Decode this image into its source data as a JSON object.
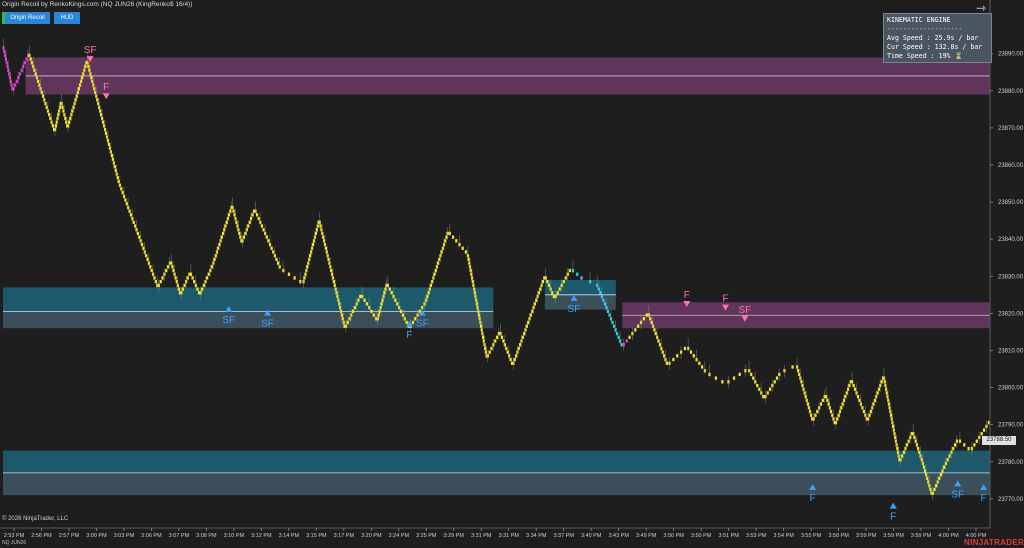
{
  "window": {
    "title": "Origin Recoil by RenkoKings.com (NQ JUN26 (KingRenko$ 16/4))",
    "buttons": [
      "Origin Recoil",
      "HUD"
    ],
    "copyright": "© 2026 NinjaTrader, LLC",
    "instrument": "NQ JUN26",
    "brand": "NINJATRADER"
  },
  "hud": {
    "header": "KINEMATIC ENGINE",
    "separator": "-------------------",
    "avg_speed": "Avg Speed  : 25.9s / bar",
    "cur_speed": "Cur Speed  : 132.8s / bar",
    "time_speed": "Time Speed : 19% ⌛"
  },
  "colors": {
    "background": "#1e1e1e",
    "up_brick": "#f5e62a",
    "down_brick": "#f5e62a",
    "wick": "#9a9a9a",
    "supply_zone": "#6b3a64",
    "demand_zone": "#1e5f73",
    "zone_lower": "#3d5460",
    "bear_marker": "#ff6fa8",
    "bull_marker": "#3aa0ff",
    "cyan_brick": "#2fd0e6",
    "magenta_brick": "#e63ad6"
  },
  "chart_data": {
    "type": "renko",
    "yaxis": {
      "ticks": [
        23890,
        23880,
        23870,
        23860,
        23850,
        23840,
        23830,
        23820,
        23810,
        23800,
        23790,
        23780,
        23770
      ],
      "ylim": [
        23767,
        23898
      ],
      "last_price": "23788.50"
    },
    "xaxis": {
      "ticks": [
        "2:53 PM",
        "2:56 PM",
        "2:57 PM",
        "3:00 PM",
        "3:03 PM",
        "3:06 PM",
        "3:07 PM",
        "3:08 PM",
        "3:10 PM",
        "3:12 PM",
        "3:14 PM",
        "3:15 PM",
        "3:17 PM",
        "3:20 PM",
        "3:24 PM",
        "3:25 PM",
        "3:29 PM",
        "3:31 PM",
        "3:31 PM",
        "3:34 PM",
        "3:37 PM",
        "3:40 PM",
        "3:43 PM",
        "3:49 PM",
        "3:50 PM",
        "3:50 PM",
        "3:51 PM",
        "3:53 PM",
        "3:54 PM",
        "3:55 PM",
        "3:58 PM",
        "3:59 PM",
        "3:59 PM",
        "3:59 PM",
        "4:00 PM",
        "4:00 PM"
      ]
    },
    "path": [
      [
        0,
        23892
      ],
      [
        3,
        23880
      ],
      [
        8,
        23890
      ],
      [
        16,
        23869
      ],
      [
        18,
        23877
      ],
      [
        20,
        23870
      ],
      [
        26,
        23888
      ],
      [
        36,
        23855
      ],
      [
        48,
        23827
      ],
      [
        52,
        23834
      ],
      [
        55,
        23825
      ],
      [
        58,
        23831
      ],
      [
        61,
        23825
      ],
      [
        65,
        23833
      ],
      [
        71,
        23849
      ],
      [
        74,
        23839
      ],
      [
        78,
        23848
      ],
      [
        86,
        23832
      ],
      [
        93,
        23828
      ],
      [
        98,
        23845
      ],
      [
        106,
        23816
      ],
      [
        111,
        23825
      ],
      [
        116,
        23818
      ],
      [
        119,
        23828
      ],
      [
        126,
        23816
      ],
      [
        131,
        23823
      ],
      [
        138,
        23842
      ],
      [
        144,
        23836
      ],
      [
        150,
        23808
      ],
      [
        154,
        23815
      ],
      [
        158,
        23806
      ],
      [
        163,
        23818
      ],
      [
        168,
        23830
      ],
      [
        171,
        23824
      ],
      [
        176,
        23832
      ],
      [
        180,
        23829
      ],
      [
        184,
        23828
      ],
      [
        192,
        23811
      ],
      [
        200,
        23820
      ],
      [
        206,
        23806
      ],
      [
        212,
        23811
      ],
      [
        218,
        23804
      ],
      [
        224,
        23801
      ],
      [
        231,
        23805
      ],
      [
        236,
        23797
      ],
      [
        241,
        23804
      ],
      [
        246,
        23806
      ],
      [
        251,
        23791
      ],
      [
        255,
        23798
      ],
      [
        258,
        23790
      ],
      [
        263,
        23802
      ],
      [
        268,
        23791
      ],
      [
        273,
        23803
      ],
      [
        278,
        23780
      ],
      [
        282,
        23788
      ],
      [
        285,
        23780
      ],
      [
        288,
        23771
      ],
      [
        292,
        23779
      ],
      [
        296,
        23786
      ],
      [
        300,
        23783
      ],
      [
        306,
        23791
      ]
    ],
    "supply_zones": [
      {
        "y_top": 23889,
        "y_bottom": 23879,
        "mid": 23884,
        "x_start": 7,
        "x_end": 306
      },
      {
        "y_top": 23823,
        "y_bottom": 23816,
        "mid": 23819.5,
        "x_start": 192,
        "x_end": 306
      }
    ],
    "demand_zones": [
      {
        "y_top": 23827,
        "y_bottom": 23816,
        "mid": 23820.5,
        "x_start": 0,
        "x_end": 152
      },
      {
        "y_top": 23829,
        "y_bottom": 23821,
        "mid": 23825,
        "x_start": 168,
        "x_end": 190
      },
      {
        "y_top": 23783,
        "y_bottom": 23771,
        "mid": 23777,
        "x_start": 0,
        "x_end": 306
      }
    ],
    "markers": [
      {
        "label": "SF",
        "side": "bear",
        "x": 27,
        "y": 23888
      },
      {
        "label": "F",
        "side": "bear",
        "x": 32,
        "y": 23878
      },
      {
        "label": "SF",
        "side": "bull",
        "x": 70,
        "y": 23822
      },
      {
        "label": "SF",
        "side": "bull",
        "x": 82,
        "y": 23821
      },
      {
        "label": "F",
        "side": "bull",
        "x": 126,
        "y": 23818
      },
      {
        "label": "SF",
        "side": "bull",
        "x": 130,
        "y": 23821
      },
      {
        "label": "SF",
        "side": "bull",
        "x": 177,
        "y": 23825
      },
      {
        "label": "F",
        "side": "bear",
        "x": 212,
        "y": 23822
      },
      {
        "label": "F",
        "side": "bear",
        "x": 224,
        "y": 23821
      },
      {
        "label": "SF",
        "side": "bear",
        "x": 230,
        "y": 23818
      },
      {
        "label": "F",
        "side": "bull",
        "x": 251,
        "y": 23774
      },
      {
        "label": "F",
        "side": "bull",
        "x": 276,
        "y": 23769
      },
      {
        "label": "SF",
        "side": "bull",
        "x": 296,
        "y": 23775
      },
      {
        "label": "F",
        "side": "bull",
        "x": 304,
        "y": 23774
      }
    ]
  }
}
